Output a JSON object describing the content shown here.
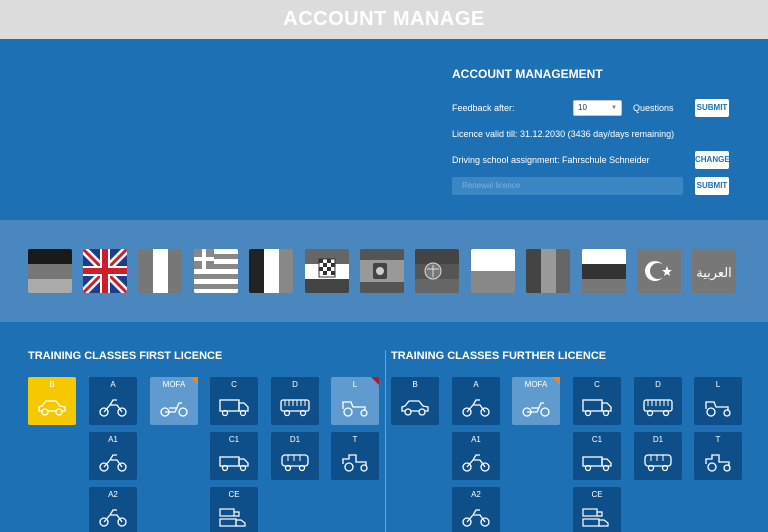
{
  "header": {
    "title": "ACCOUNT MANAGE"
  },
  "account": {
    "title": "ACCOUNT MANAGEMENT",
    "feedback_label": "Feedback after:",
    "feedback_value": "10",
    "questions_label": "Questions",
    "submit_label": "SUBMIT",
    "licence_text": "Licence valid till: 31.12.2030 (3436 day/days remaining)",
    "school_text": "Driving school assignment: Fahrschule Schneider",
    "change_label": "CHANGE",
    "renewal_placeholder": "Renewal licence"
  },
  "flags": [
    {
      "name": "german-flag"
    },
    {
      "name": "english-flag"
    },
    {
      "name": "italian-flag"
    },
    {
      "name": "greek-flag"
    },
    {
      "name": "french-flag"
    },
    {
      "name": "croatian-flag"
    },
    {
      "name": "spanish-flag"
    },
    {
      "name": "serbian-flag"
    },
    {
      "name": "polish-flag"
    },
    {
      "name": "romanian-flag"
    },
    {
      "name": "russian-flag"
    },
    {
      "name": "turkish-flag"
    },
    {
      "name": "arabic-flag",
      "text": "العربية"
    }
  ],
  "first_licence": {
    "title": "TRAINING CLASSES FIRST LICENCE",
    "classes": [
      "B",
      "A",
      "MOFA",
      "C",
      "D",
      "L",
      "A1",
      "C1",
      "D1",
      "T",
      "A2",
      "CE"
    ]
  },
  "further_licence": {
    "title": "TRAINING CLASSES FURTHER LICENCE",
    "classes": [
      "B",
      "A",
      "MOFA",
      "C",
      "D",
      "L",
      "A1",
      "C1",
      "D1",
      "T",
      "A2",
      "CE"
    ]
  },
  "colors": {
    "background": "#1e70b4",
    "tile": "#0e4f8a",
    "selected": "#f5c800",
    "header": "#dcdcdc"
  }
}
